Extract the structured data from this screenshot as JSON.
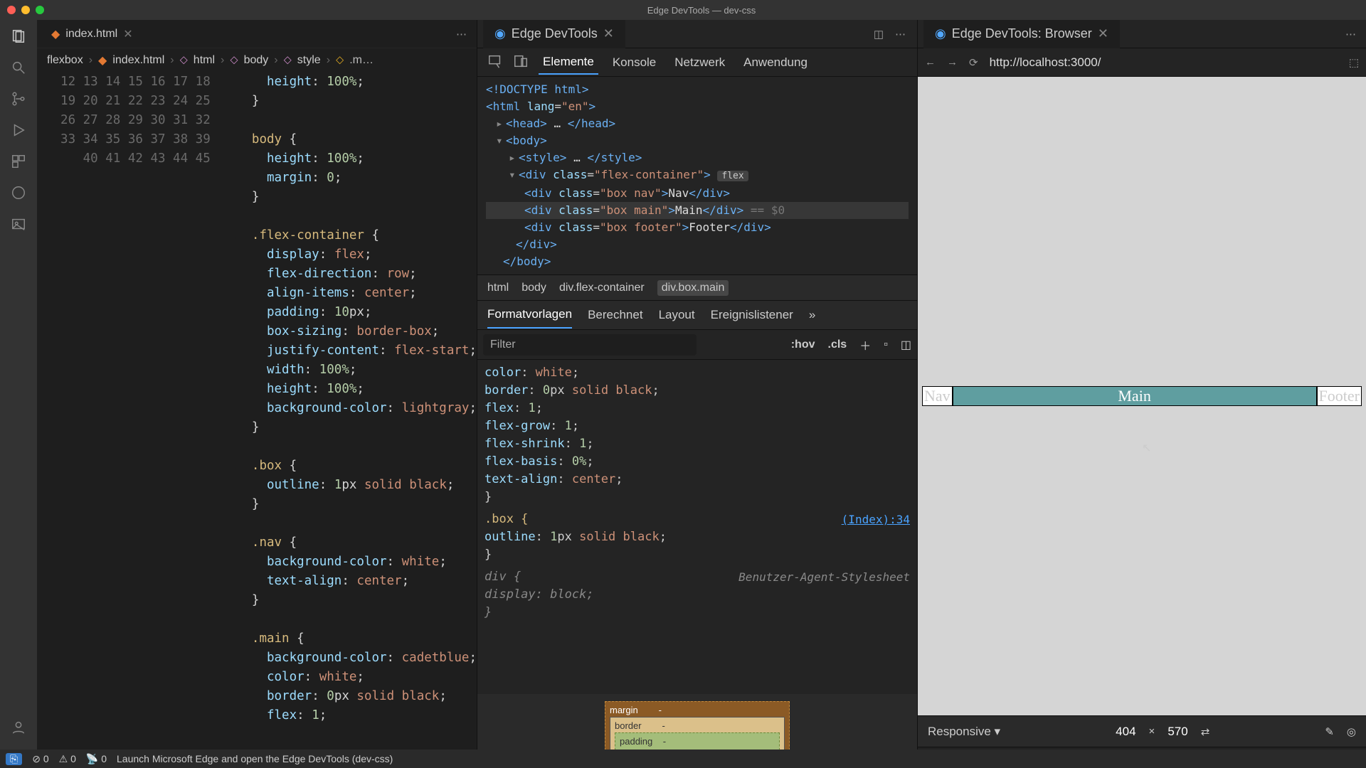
{
  "window": {
    "title": "Edge DevTools — dev-css"
  },
  "editor": {
    "tab": {
      "label": "index.html"
    },
    "breadcrumb": [
      "flexbox",
      "index.html",
      "html",
      "body",
      "style",
      ".m…"
    ],
    "lines": [
      {
        "n": 12,
        "t": "      height: 100%;"
      },
      {
        "n": 13,
        "t": "    }"
      },
      {
        "n": 14,
        "t": ""
      },
      {
        "n": 15,
        "t": "    body {"
      },
      {
        "n": 16,
        "t": "      height: 100%;"
      },
      {
        "n": 17,
        "t": "      margin: 0;"
      },
      {
        "n": 18,
        "t": "    }"
      },
      {
        "n": 19,
        "t": ""
      },
      {
        "n": 20,
        "t": "    .flex-container {"
      },
      {
        "n": 21,
        "t": "      display: flex;"
      },
      {
        "n": 22,
        "t": "      flex-direction: row;"
      },
      {
        "n": 23,
        "t": "      align-items: center;"
      },
      {
        "n": 24,
        "t": "      padding: 10px;"
      },
      {
        "n": 25,
        "t": "      box-sizing: border-box;"
      },
      {
        "n": 26,
        "t": "      justify-content: flex-start;"
      },
      {
        "n": 27,
        "t": "      width: 100%;"
      },
      {
        "n": 28,
        "t": "      height: 100%;"
      },
      {
        "n": 29,
        "t": "      background-color: lightgray;"
      },
      {
        "n": 30,
        "t": "    }"
      },
      {
        "n": 31,
        "t": ""
      },
      {
        "n": 32,
        "t": "    .box {"
      },
      {
        "n": 33,
        "t": "      outline: 1px solid black;"
      },
      {
        "n": 34,
        "t": "    }"
      },
      {
        "n": 35,
        "t": ""
      },
      {
        "n": 36,
        "t": "    .nav {"
      },
      {
        "n": 37,
        "t": "      background-color: white;"
      },
      {
        "n": 38,
        "t": "      text-align: center;"
      },
      {
        "n": 39,
        "t": "    }"
      },
      {
        "n": 40,
        "t": ""
      },
      {
        "n": 41,
        "t": "    .main {"
      },
      {
        "n": 42,
        "t": "      background-color: cadetblue;"
      },
      {
        "n": 43,
        "t": "      color: white;"
      },
      {
        "n": 44,
        "t": "      border: 0px solid black;"
      },
      {
        "n": 45,
        "t": "      flex: 1;"
      }
    ]
  },
  "devtools": {
    "tab": "Edge DevTools",
    "tabs": [
      "Elemente",
      "Konsole",
      "Netzwerk",
      "Anwendung"
    ],
    "active_tab": "Elemente",
    "dom": {
      "doctype": "<!DOCTYPE html>",
      "html_open": "<html lang=\"en\">",
      "head": "<head> … </head>",
      "body_open": "<body>",
      "style": "<style> … </style>",
      "container": "<div class=\"flex-container\"> flex",
      "nav": "<div class=\"box nav\">Nav</div>",
      "main": "<div class=\"box main\">Main</div> == $0",
      "footer": "<div class=\"box footer\">Footer</div>",
      "div_close": "</div>",
      "body_close": "</body>"
    },
    "crumbs": [
      "html",
      "body",
      "div.flex-container",
      "div.box.main"
    ],
    "styles_tabs": [
      "Formatvorlagen",
      "Berechnet",
      "Layout",
      "Ereignislistener"
    ],
    "filter_placeholder": "Filter",
    "buttons": {
      "hov": ":hov",
      "cls": ".cls"
    },
    "rules": {
      "r1": [
        "  color: white;",
        "  border: 0px solid black;",
        "  flex: 1;",
        "    flex-grow: 1;",
        "    flex-shrink: 1;",
        "    flex-basis: 0%;",
        "  text-align: center;",
        "}"
      ],
      "r2_sel": ".box {",
      "r2_link": "(Index):34",
      "r2_body": [
        "  outline: 1px solid black;",
        "}"
      ],
      "r3_sel": "div {",
      "r3_src": "Benutzer-Agent-Stylesheet",
      "r3_body": [
        "  display: block;",
        "}"
      ]
    },
    "boxmodel": {
      "margin": "margin",
      "mval": "-",
      "border": "border",
      "bval": "-",
      "padding": "padding",
      "pval": "-"
    }
  },
  "browser": {
    "tab": "Edge DevTools: Browser",
    "url": "http://localhost:3000/",
    "nav_txt": "Nav",
    "main_txt": "Main",
    "footer_txt": "Footer",
    "devsize": {
      "mode": "Responsive",
      "w": "404",
      "h": "570",
      "sep": "×"
    }
  },
  "status": {
    "errors": "0",
    "warnings": "0",
    "port": "0",
    "msg": "Launch Microsoft Edge and open the Edge DevTools (dev-css)"
  }
}
